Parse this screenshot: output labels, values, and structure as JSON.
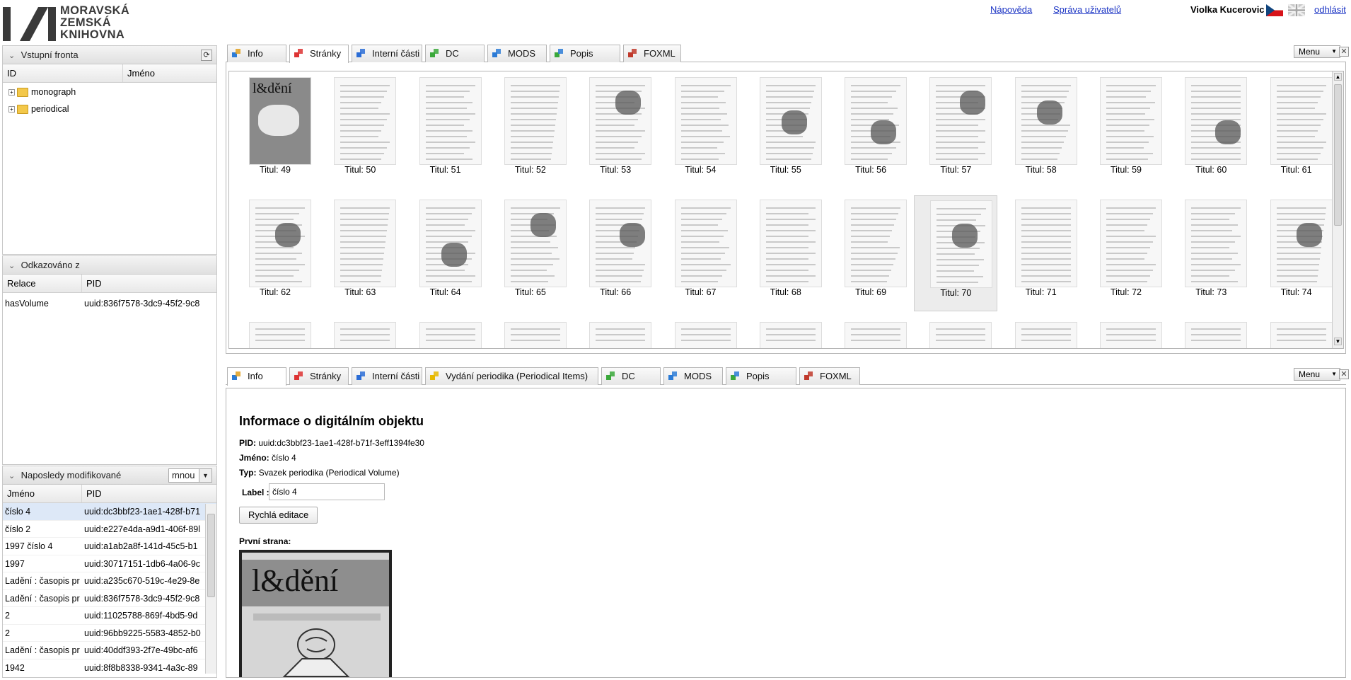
{
  "header": {
    "logo_lines": [
      "MORAVSKÁ",
      "ZEMSKÁ",
      "KNIHOVNA"
    ],
    "help_link": "Nápověda",
    "users_link": "Správa uživatelů",
    "user_name": "Violka Kucerovic",
    "logout_link": "odhlásit"
  },
  "input_queue": {
    "title": "Vstupní fronta",
    "columns": [
      "ID",
      "Jméno"
    ],
    "items": [
      "monograph",
      "periodical"
    ]
  },
  "referenced": {
    "title": "Odkazováno z",
    "columns": [
      "Relace",
      "PID"
    ],
    "rows": [
      {
        "rel": "hasVolume",
        "pid": "uuid:836f7578-3dc9-45f2-9c8"
      }
    ]
  },
  "recent": {
    "title": "Naposledy modifikované",
    "filter_value": "mnou",
    "columns": [
      "Jméno",
      "PID"
    ],
    "rows": [
      {
        "name": "číslo 4",
        "pid": "uuid:dc3bbf23-1ae1-428f-b71"
      },
      {
        "name": "číslo 2",
        "pid": "uuid:e227e4da-a9d1-406f-89l"
      },
      {
        "name": "1997 číslo 4",
        "pid": "uuid:a1ab2a8f-141d-45c5-b1"
      },
      {
        "name": "1997",
        "pid": "uuid:30717151-1db6-4a06-9c"
      },
      {
        "name": "Ladění : časopis pr",
        "pid": "uuid:a235c670-519c-4e29-8e"
      },
      {
        "name": "Ladění : časopis pr",
        "pid": "uuid:836f7578-3dc9-45f2-9c8"
      },
      {
        "name": "2",
        "pid": "uuid:11025788-869f-4bd5-9d"
      },
      {
        "name": "2",
        "pid": "uuid:96bb9225-5583-4852-b0"
      },
      {
        "name": "Ladění : časopis pr",
        "pid": "uuid:40ddf393-2f7e-49bc-af6"
      },
      {
        "name": "1942",
        "pid": "uuid:8f8b8338-9341-4a3c-89"
      }
    ]
  },
  "top_tabs": [
    "Info",
    "Stránky",
    "Interní části",
    "DC",
    "MODS",
    "Popis",
    "FOXML"
  ],
  "bottom_tabs": [
    "Info",
    "Stránky",
    "Interní části",
    "Vydání periodika (Periodical Items)",
    "DC",
    "MODS",
    "Popis",
    "FOXML"
  ],
  "menu_label": "Menu",
  "thumbnails": [
    "Titul: 49",
    "Titul: 50",
    "Titul: 51",
    "Titul: 52",
    "Titul: 53",
    "Titul: 54",
    "Titul: 55",
    "Titul: 56",
    "Titul: 57",
    "Titul: 58",
    "Titul: 59",
    "Titul: 60",
    "Titul: 61",
    "Titul: 62",
    "Titul: 63",
    "Titul: 64",
    "Titul: 65",
    "Titul: 66",
    "Titul: 67",
    "Titul: 68",
    "Titul: 69",
    "Titul: 70",
    "Titul: 71",
    "Titul: 72",
    "Titul: 73",
    "Titul: 74"
  ],
  "info": {
    "heading": "Informace o digitálním objektu",
    "pid_label": "PID:",
    "pid_value": "uuid:dc3bbf23-1ae1-428f-b71f-3eff1394fe30",
    "name_label": "Jméno:",
    "name_value": "číslo 4",
    "type_label": "Typ:",
    "type_value": "Svazek periodika (Periodical Volume)",
    "label_label": "Label :",
    "label_value": "číslo 4",
    "quick_edit": "Rychlá editace",
    "first_page": "První strana:",
    "cover_title": "l&dění"
  }
}
